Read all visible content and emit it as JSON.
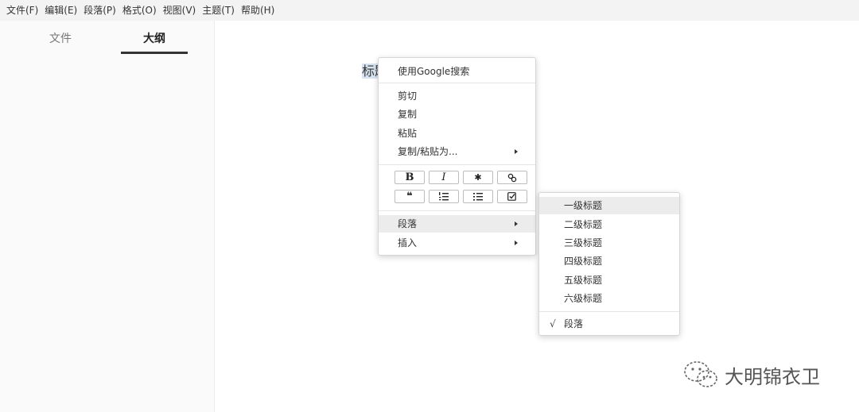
{
  "menubar": {
    "items": [
      "文件(F)",
      "编辑(E)",
      "段落(P)",
      "格式(O)",
      "视图(V)",
      "主题(T)",
      "帮助(H)"
    ]
  },
  "sidebar": {
    "tabs": [
      {
        "label": "文件",
        "active": false
      },
      {
        "label": "大纲",
        "active": true
      }
    ]
  },
  "editor": {
    "heading_text": "标题"
  },
  "context_menu": {
    "google_search": "使用Google搜索",
    "cut": "剪切",
    "copy": "复制",
    "paste": "粘贴",
    "copy_paste_as": "复制/粘贴为...",
    "format_buttons": [
      {
        "name": "bold",
        "glyph": "B"
      },
      {
        "name": "italic",
        "glyph": "I"
      },
      {
        "name": "emphasis",
        "glyph": "✱"
      },
      {
        "name": "link",
        "glyph": "link-icon"
      },
      {
        "name": "quote",
        "glyph": "❝"
      },
      {
        "name": "ordered-list",
        "glyph": "ordered-list-icon"
      },
      {
        "name": "unordered-list",
        "glyph": "unordered-list-icon"
      },
      {
        "name": "task-list",
        "glyph": "checkbox-icon"
      }
    ],
    "paragraph": "段落",
    "insert": "插入"
  },
  "paragraph_submenu": {
    "items": [
      "一级标题",
      "二级标题",
      "三级标题",
      "四级标题",
      "五级标题",
      "六级标题"
    ],
    "active_index": 0,
    "paragraph_checkmark": "√",
    "paragraph_label": "段落"
  },
  "watermark": {
    "text": "大明锦衣卫"
  },
  "colors": {
    "menubar_bg": "#f3f3f3",
    "sidebar_bg": "#fafafa",
    "hover_bg": "#ececec",
    "selection_bg": "#d7e3f0"
  }
}
